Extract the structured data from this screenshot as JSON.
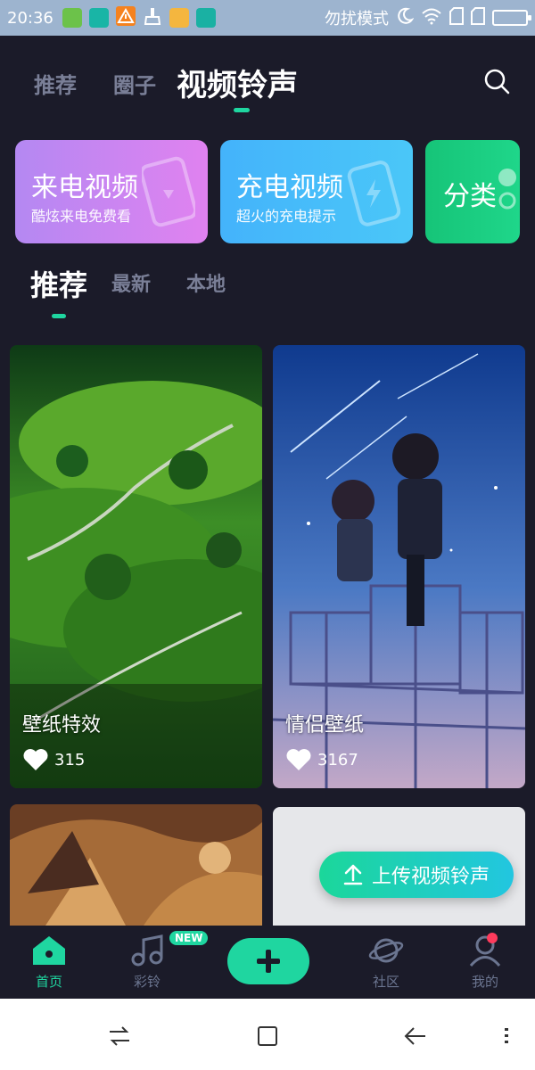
{
  "status_bar": {
    "time": "20:36",
    "dnd_text": "勿扰模式",
    "left_icons": [
      "app-icon-green",
      "app-icon-teal",
      "warning-icon",
      "broom-icon",
      "folder-icon",
      "usb-icon"
    ],
    "right_icons": [
      "moon-icon",
      "wifi-icon",
      "sim-icon",
      "sim-icon",
      "battery-icon"
    ]
  },
  "top_tabs": {
    "items": [
      {
        "label": "推荐"
      },
      {
        "label": "圈子"
      },
      {
        "label": "视频铃声"
      }
    ],
    "active_index": 2
  },
  "features": [
    {
      "title": "来电视频",
      "subtitle": "酷炫来电免费看",
      "color_from": "#b488f2",
      "color_to": "#e082f0",
      "icon": "phone-icon"
    },
    {
      "title": "充电视频",
      "subtitle": "超火的充电提示",
      "color_from": "#44b3fb",
      "color_to": "#4ac7f8",
      "icon": "battery-charge-icon"
    },
    {
      "title": "分类",
      "subtitle": "",
      "color_from": "#16c478",
      "color_to": "#1fd68a",
      "icon": "category-icon"
    }
  ],
  "sub_tabs": {
    "items": [
      {
        "label": "推荐"
      },
      {
        "label": "最新"
      },
      {
        "label": "本地"
      }
    ],
    "active_index": 0
  },
  "videos": [
    {
      "title": "壁纸特效",
      "likes": "315",
      "image": "green-hills-landscape"
    },
    {
      "title": "情侣壁纸",
      "likes": "3167",
      "image": "anime-couple-starry-night"
    },
    {
      "title": "",
      "likes": "",
      "image": "golden-armor-artwork"
    },
    {
      "title": "",
      "likes": "",
      "image": "light-gray-card"
    }
  ],
  "upload_button": {
    "label": "上传视频铃声",
    "icon": "upload-arrow-icon"
  },
  "bottom_nav": {
    "items": [
      {
        "label": "首页",
        "icon": "home-icon"
      },
      {
        "label": "彩铃",
        "icon": "music-note-icon",
        "badge": "NEW"
      },
      {
        "label": "",
        "icon": "plus-icon"
      },
      {
        "label": "社区",
        "icon": "planet-icon"
      },
      {
        "label": "我的",
        "icon": "profile-icon"
      }
    ],
    "active_index": 0
  },
  "colors": {
    "background": "#1b1b29",
    "accent": "#1fd6a0",
    "inactive": "#7a7f97"
  }
}
